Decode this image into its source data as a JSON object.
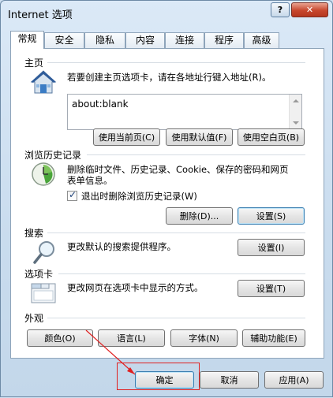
{
  "window": {
    "title": "Internet 选项",
    "help_label": "?",
    "close_label": "✕"
  },
  "tabs": [
    {
      "label": "常规"
    },
    {
      "label": "安全"
    },
    {
      "label": "隐私"
    },
    {
      "label": "内容"
    },
    {
      "label": "连接"
    },
    {
      "label": "程序"
    },
    {
      "label": "高级"
    }
  ],
  "homepage": {
    "title": "主页",
    "description": "若要创建主页选项卡，请在各地址行键入地址(R)。",
    "value": "about:blank",
    "buttons": [
      "使用当前页(C)",
      "使用默认值(F)",
      "使用空白页(B)"
    ]
  },
  "history": {
    "title": "浏览历史记录",
    "description_line1": "删除临时文件、历史记录、Cookie、保存的密码和网页",
    "description_line2": "表单信息。",
    "checkbox_label": "退出时删除浏览历史记录(W)",
    "checkbox_checked": true,
    "delete_button": "删除(D)...",
    "settings_button": "设置(S)"
  },
  "search": {
    "title": "搜索",
    "description": "更改默认的搜索提供程序。",
    "settings_button": "设置(I)"
  },
  "tabs_group": {
    "title": "选项卡",
    "description": "更改网页在选项卡中显示的方式。",
    "settings_button": "设置(T)"
  },
  "appearance": {
    "title": "外观",
    "buttons": [
      "颜色(O)",
      "语言(L)",
      "字体(N)",
      "辅助功能(E)"
    ]
  },
  "footer": {
    "ok": "确定",
    "cancel": "取消",
    "apply": "应用(A)"
  },
  "annotation_color": "#e02020"
}
